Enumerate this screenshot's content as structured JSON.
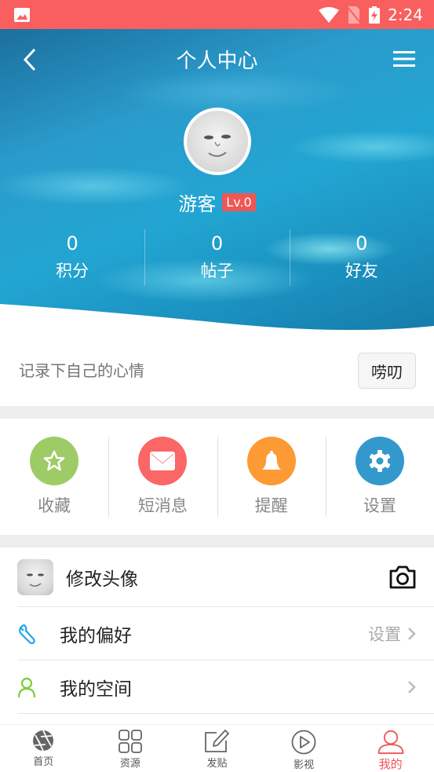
{
  "status_bar": {
    "time": "2:24",
    "icons": [
      "image-notification-icon",
      "wifi-icon",
      "no-sim-icon",
      "battery-charging-icon"
    ],
    "bg_color": "#f95f5e"
  },
  "header": {
    "title": "个人中心",
    "back_icon": "chevron-left-icon",
    "menu_icon": "hamburger-menu-icon"
  },
  "profile": {
    "username": "游客",
    "level": "Lv.0",
    "stats": [
      {
        "value": "0",
        "label": "积分"
      },
      {
        "value": "0",
        "label": "帖子"
      },
      {
        "value": "0",
        "label": "好友"
      }
    ]
  },
  "mood": {
    "placeholder": "记录下自己的心情",
    "button_label": "唠叨"
  },
  "quick_actions": [
    {
      "label": "收藏",
      "icon": "star-icon",
      "color": "#9dcc67"
    },
    {
      "label": "短消息",
      "icon": "envelope-icon",
      "color": "#fb6667"
    },
    {
      "label": "提醒",
      "icon": "bell-icon",
      "color": "#fd9a33"
    },
    {
      "label": "设置",
      "icon": "gear-icon",
      "color": "#3399cc"
    }
  ],
  "menu_list": [
    {
      "label": "修改头像",
      "icon": "camera-icon"
    },
    {
      "label": "我的偏好",
      "extra": "设置",
      "icon": "wrench-icon",
      "icon_color": "#1ea5e8"
    },
    {
      "label": "我的空间",
      "icon": "user-icon",
      "icon_color": "#7ccc3a"
    }
  ],
  "tabbar": {
    "items": [
      {
        "label": "首页",
        "icon": "aperture-icon"
      },
      {
        "label": "资源",
        "icon": "grid-icon"
      },
      {
        "label": "发贴",
        "icon": "edit-icon"
      },
      {
        "label": "影视",
        "icon": "play-circle-icon"
      },
      {
        "label": "我的",
        "icon": "user-icon",
        "active": true
      }
    ],
    "active_color": "#f05656"
  }
}
